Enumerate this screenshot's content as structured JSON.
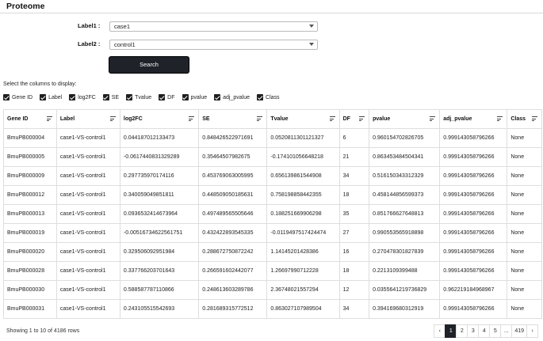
{
  "header": {
    "title": "Proteome"
  },
  "form": {
    "label1": "Label1 :",
    "label1_value": "case1",
    "label2": "Label2 :",
    "label2_value": "control1",
    "search_label": "Search"
  },
  "columns_selector": {
    "caption": "Select the columns to display:",
    "items": [
      "Gene ID",
      "Label",
      "log2FC",
      "SE",
      "Tvalue",
      "DF",
      "pvalue",
      "adj_pvalue",
      "Class"
    ]
  },
  "table": {
    "headers": [
      "Gene ID",
      "Label",
      "log2FC",
      "SE",
      "Tvalue",
      "DF",
      "pvalue",
      "adj_pvalue",
      "Class"
    ],
    "rows": [
      [
        "BmuPB000004",
        "case1-VS-control1",
        "0.044187012133473",
        "0.848426522971691",
        "0.0520811301121327",
        "6",
        "0.960154702826705",
        "0.999143058796266",
        "None"
      ],
      [
        "BmuPB000005",
        "case1-VS-control1",
        "-0.0617440831329289",
        "0.35464507982675",
        "-0.174101056648218",
        "21",
        "0.863453484504341",
        "0.999143058796266",
        "None"
      ],
      [
        "BmuPB000009",
        "case1-VS-control1",
        "0.297735970174116",
        "0.453769063005995",
        "0.656139861544908",
        "34",
        "0.516150343312329",
        "0.999143058796266",
        "None"
      ],
      [
        "BmuPB000012",
        "case1-VS-control1",
        "0.340059049851811",
        "0.448509050185631",
        "0.758198858442355",
        "18",
        "0.458144856599373",
        "0.999143058796266",
        "None"
      ],
      [
        "BmuPB000013",
        "case1-VS-control1",
        "0.0936532414673964",
        "0.497489565505646",
        "0.188251669906298",
        "35",
        "0.851766627648813",
        "0.999143058796266",
        "None"
      ],
      [
        "BmuPB000019",
        "case1-VS-control1",
        "-0.00516734622561751",
        "0.432422893545335",
        "-0.0119497517424474",
        "27",
        "0.990553565918898",
        "0.999143058796266",
        "None"
      ],
      [
        "BmuPB000020",
        "case1-VS-control1",
        "0.329506092951984",
        "0.288672750872242",
        "1.14145201428386",
        "16",
        "0.270478301827839",
        "0.999143058796266",
        "None"
      ],
      [
        "BmuPB000028",
        "case1-VS-control1",
        "0.337766203701643",
        "0.266591602442077",
        "1.26697990712228",
        "18",
        "0.2213109399488",
        "0.999143058796266",
        "None"
      ],
      [
        "BmuPB000030",
        "case1-VS-control1",
        "0.588587787110866",
        "0.248613603289786",
        "2.36748021557294",
        "12",
        "0.0355641219736829",
        "0.962219184968967",
        "None"
      ],
      [
        "BmuPB000031",
        "case1-VS-control1",
        "0.243105515542693",
        "0.281689315772512",
        "0.863027107989504",
        "34",
        "0.394169680312919",
        "0.999143058796266",
        "None"
      ]
    ]
  },
  "footer": {
    "info": "Showing 1 to 10 of 4186 rows",
    "pages": [
      "‹",
      "1",
      "2",
      "3",
      "4",
      "5",
      "...",
      "419",
      "›"
    ],
    "active_page": "1"
  }
}
